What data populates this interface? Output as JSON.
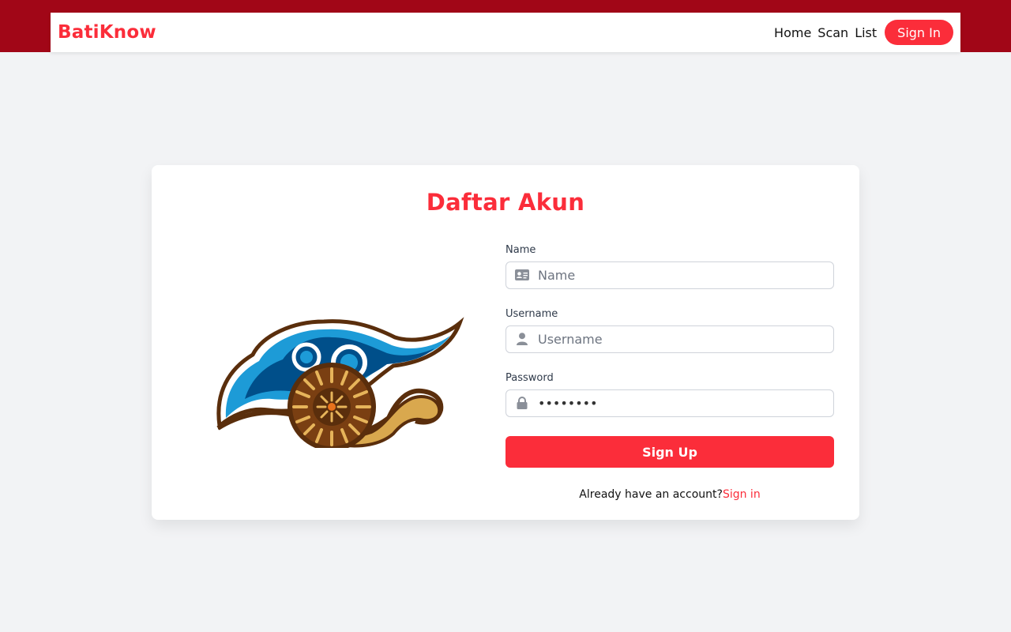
{
  "navbar": {
    "brand": "BatiKnow",
    "links": [
      "Home",
      "Scan",
      "List"
    ],
    "signin_label": "Sign In"
  },
  "form": {
    "title": "Daftar Akun",
    "name_label": "Name",
    "name_placeholder": "Name",
    "username_label": "Username",
    "username_placeholder": "Username",
    "password_label": "Password",
    "password_value": "12345678",
    "submit_label": "Sign Up",
    "footer_text": "Already have an account?",
    "footer_link": "Sign in"
  },
  "icons": {
    "name": "id-card-icon",
    "username": "user-icon",
    "password": "lock-icon"
  },
  "colors": {
    "accent": "#fb2d3a",
    "topbar": "#a10617",
    "background": "#f2f3f5"
  }
}
